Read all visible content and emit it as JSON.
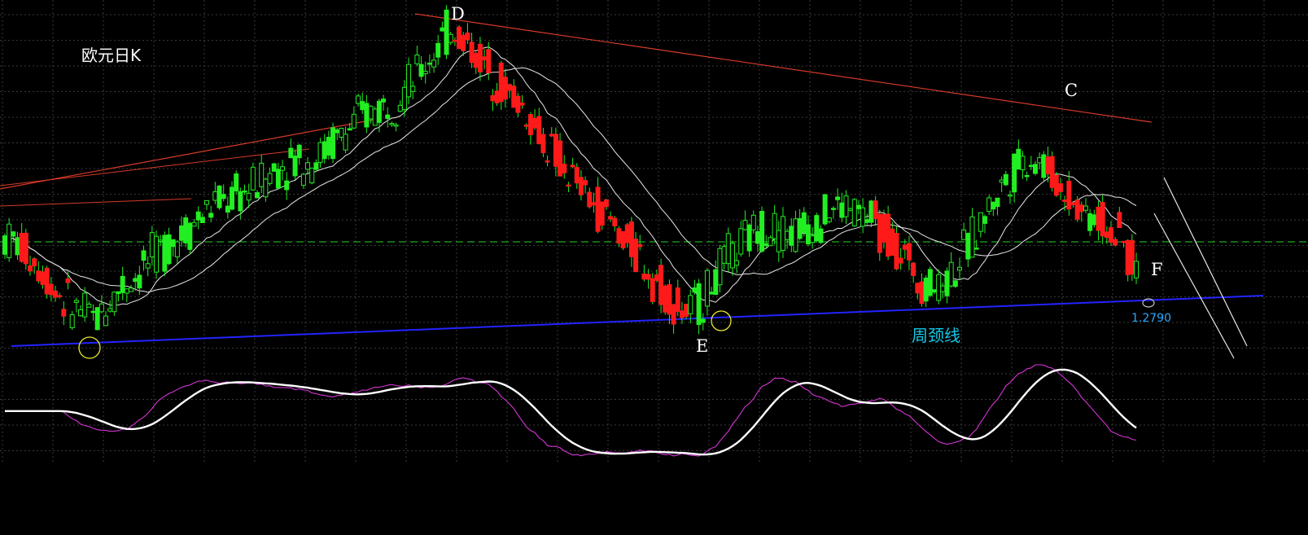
{
  "chart_data": {
    "type": "candlestick",
    "title": "欧元日K",
    "neckline_label": "周颈线",
    "price_label": "1.2790",
    "point_labels": [
      {
        "name": "D",
        "text": "D"
      },
      {
        "name": "C",
        "text": "C"
      },
      {
        "name": "E",
        "text": "E"
      },
      {
        "name": "F",
        "text": "F"
      }
    ],
    "price_path": [
      1.318,
      1.316,
      1.311,
      1.305,
      1.298,
      1.292,
      1.289,
      1.287,
      1.294,
      1.3,
      1.304,
      1.309,
      1.314,
      1.318,
      1.322,
      1.327,
      1.331,
      1.333,
      1.335,
      1.338,
      1.342,
      1.346,
      1.348,
      1.347,
      1.35,
      1.355,
      1.359,
      1.364,
      1.367,
      1.369,
      1.373,
      1.378,
      1.385,
      1.392,
      1.399,
      1.394,
      1.388,
      1.382,
      1.376,
      1.371,
      1.364,
      1.356,
      1.349,
      1.342,
      1.336,
      1.331,
      1.325,
      1.319,
      1.313,
      1.306,
      1.299,
      1.293,
      1.289,
      1.294,
      1.303,
      1.31,
      1.315,
      1.321,
      1.323,
      1.321,
      1.32,
      1.323,
      1.326,
      1.329,
      1.33,
      1.327,
      1.324,
      1.32,
      1.314,
      1.307,
      1.301,
      1.299,
      1.305,
      1.313,
      1.322,
      1.331,
      1.339,
      1.346,
      1.349,
      1.346,
      1.34,
      1.334,
      1.329,
      1.326,
      1.322,
      1.316,
      1.307
    ],
    "candle_colors": {
      "up": "#22ee22",
      "down": "#ff1a1a",
      "wick": "#22ee22"
    },
    "ma_color": "#e8e8e8",
    "trend_color": "#d63a2a",
    "neckline_color": "#2323ff",
    "support_color": "#22aa22",
    "osc_fast_color": "#d534d5",
    "osc_slow_color": "#ffffff",
    "circle_color": "#e8e830",
    "grid": true
  }
}
